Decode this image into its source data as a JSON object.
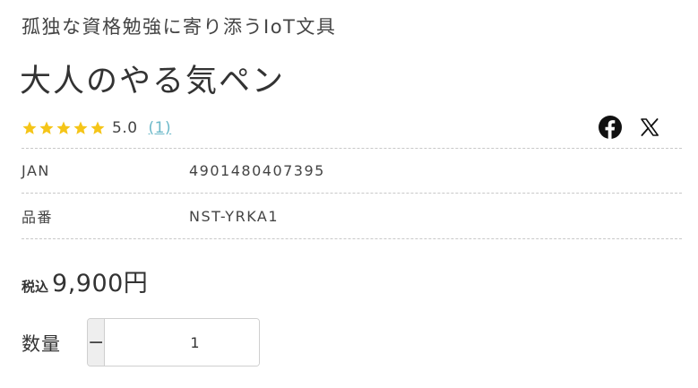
{
  "product": {
    "subtitle": "孤独な資格勉強に寄り添うIoT文具",
    "title": "大人のやる気ペン"
  },
  "rating": {
    "stars": 5,
    "star_color": "#f5c518",
    "value": "5.0",
    "count": "(1)"
  },
  "share": {
    "facebook_icon": "facebook-icon",
    "x_icon": "x-icon"
  },
  "specs": [
    {
      "label": "JAN",
      "value": "4901480407395"
    },
    {
      "label": "品番",
      "value": "NST-YRKA1"
    }
  ],
  "price": {
    "tax_label": "税込",
    "amount": "9,900円"
  },
  "quantity": {
    "label": "数量",
    "minus": "−",
    "plus": "+",
    "value": "1"
  }
}
